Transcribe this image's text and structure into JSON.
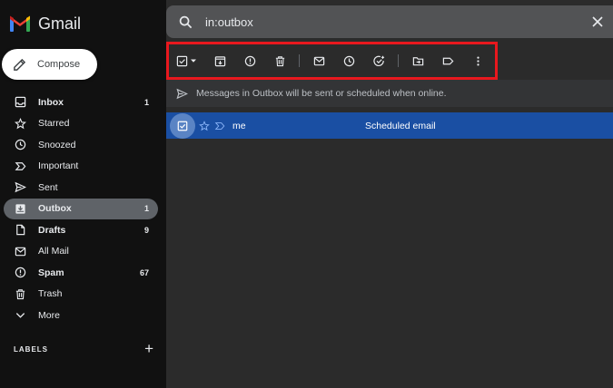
{
  "app": {
    "name": "Gmail"
  },
  "compose": {
    "label": "Compose"
  },
  "nav": {
    "items": [
      {
        "label": "Inbox",
        "count": "1",
        "icon": "inbox-icon",
        "bold": true
      },
      {
        "label": "Starred",
        "count": "",
        "icon": "star-icon",
        "bold": false
      },
      {
        "label": "Snoozed",
        "count": "",
        "icon": "clock-icon",
        "bold": false
      },
      {
        "label": "Important",
        "count": "",
        "icon": "important-icon",
        "bold": false
      },
      {
        "label": "Sent",
        "count": "",
        "icon": "send-icon",
        "bold": false
      },
      {
        "label": "Outbox",
        "count": "1",
        "icon": "outbox-icon",
        "bold": true,
        "active": true
      },
      {
        "label": "Drafts",
        "count": "9",
        "icon": "draft-icon",
        "bold": true
      },
      {
        "label": "All Mail",
        "count": "",
        "icon": "mail-icon",
        "bold": false
      },
      {
        "label": "Spam",
        "count": "67",
        "icon": "spam-icon",
        "bold": true
      },
      {
        "label": "Trash",
        "count": "",
        "icon": "trash-icon",
        "bold": false
      },
      {
        "label": "More",
        "count": "",
        "icon": "chevron-down-icon",
        "bold": false
      }
    ]
  },
  "labels": {
    "heading": "LABELS",
    "add": "+"
  },
  "search": {
    "value": "in:outbox"
  },
  "info": {
    "text": "Messages in Outbox will be sent or scheduled when online."
  },
  "message": {
    "sender": "me",
    "subject": "Scheduled email"
  },
  "colors": {
    "selected_row": "#1a4fa3",
    "highlight_box": "#e8181e",
    "active_nav": "#5f6368"
  }
}
